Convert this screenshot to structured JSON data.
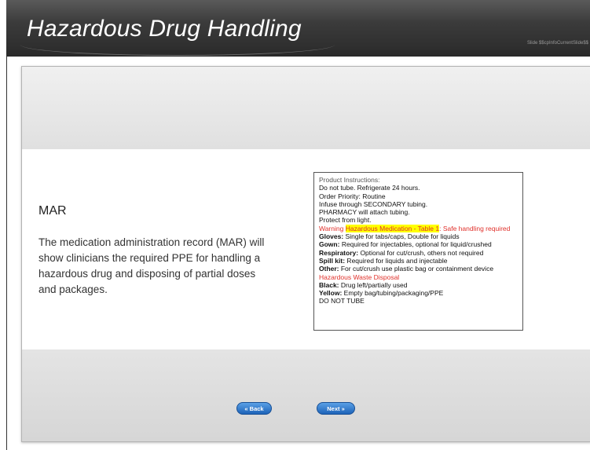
{
  "header": {
    "title": "Hazardous Drug Handling",
    "slide_info": "Slide $$cpInfoCurrentSlide$$"
  },
  "slide": {
    "heading": "MAR",
    "body": "The medication administration record (MAR) will show clinicians the required PPE for handling a hazardous drug and disposing of partial doses and packages."
  },
  "instructions": {
    "header": "Product Instructions:",
    "lines": [
      "Do not tube. Refrigerate 24 hours.",
      "Order Priority: Routine",
      "Infuse through SECONDARY tubing.",
      "PHARMACY will attach tubing.",
      "Protect from light."
    ],
    "warning_prefix": "Warning ",
    "warning_highlight": "Hazardous Medication - Table 1",
    "warning_suffix": ": Safe handling required",
    "ppe": [
      {
        "label": "Gloves:",
        "text": " Single for tabs/caps, Double for liquids"
      },
      {
        "label": "Gown:",
        "text": " Required for injectables, optional for liquid/crushed"
      },
      {
        "label": "Respiratory:",
        "text": " Optional for cut/crush, others not required"
      },
      {
        "label": "Spill kit:",
        "text": " Required for liquids and injectable"
      },
      {
        "label": "Other:",
        "text": " For cut/crush use plastic bag or containment device"
      }
    ],
    "waste_heading": "Hazardous Waste Disposal",
    "waste": [
      {
        "label": "Black:",
        "text": " Drug left/partially used"
      },
      {
        "label": "Yellow:",
        "text": " Empty bag/tubing/packaging/PPE"
      }
    ],
    "footer": "DO NOT TUBE"
  },
  "nav": {
    "back_label": "« Back",
    "next_label": "Next »"
  },
  "colors": {
    "header_bg": "#3b3b3b",
    "warning_red": "#e0302a",
    "highlight_yellow": "#ffff00",
    "button_blue": "#2a74c9"
  }
}
